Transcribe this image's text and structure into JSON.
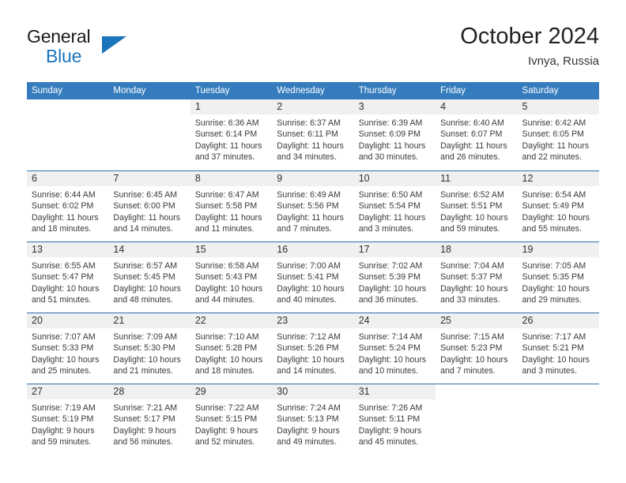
{
  "brand": {
    "name_part1": "General",
    "name_part2": "Blue",
    "accent_color": "#1b75bb"
  },
  "header": {
    "title": "October 2024",
    "location": "Ivnya, Russia"
  },
  "theme": {
    "header_bar_color": "#357cbe",
    "row_separator_color": "#2f6fae",
    "day_number_band_color": "#f0f0f0"
  },
  "weekdays": [
    "Sunday",
    "Monday",
    "Tuesday",
    "Wednesday",
    "Thursday",
    "Friday",
    "Saturday"
  ],
  "weeks": [
    [
      {
        "day": "",
        "empty": true
      },
      {
        "day": "",
        "empty": true
      },
      {
        "day": "1",
        "sunrise": "Sunrise: 6:36 AM",
        "sunset": "Sunset: 6:14 PM",
        "daylight": "Daylight: 11 hours and 37 minutes."
      },
      {
        "day": "2",
        "sunrise": "Sunrise: 6:37 AM",
        "sunset": "Sunset: 6:11 PM",
        "daylight": "Daylight: 11 hours and 34 minutes."
      },
      {
        "day": "3",
        "sunrise": "Sunrise: 6:39 AM",
        "sunset": "Sunset: 6:09 PM",
        "daylight": "Daylight: 11 hours and 30 minutes."
      },
      {
        "day": "4",
        "sunrise": "Sunrise: 6:40 AM",
        "sunset": "Sunset: 6:07 PM",
        "daylight": "Daylight: 11 hours and 26 minutes."
      },
      {
        "day": "5",
        "sunrise": "Sunrise: 6:42 AM",
        "sunset": "Sunset: 6:05 PM",
        "daylight": "Daylight: 11 hours and 22 minutes."
      }
    ],
    [
      {
        "day": "6",
        "sunrise": "Sunrise: 6:44 AM",
        "sunset": "Sunset: 6:02 PM",
        "daylight": "Daylight: 11 hours and 18 minutes."
      },
      {
        "day": "7",
        "sunrise": "Sunrise: 6:45 AM",
        "sunset": "Sunset: 6:00 PM",
        "daylight": "Daylight: 11 hours and 14 minutes."
      },
      {
        "day": "8",
        "sunrise": "Sunrise: 6:47 AM",
        "sunset": "Sunset: 5:58 PM",
        "daylight": "Daylight: 11 hours and 11 minutes."
      },
      {
        "day": "9",
        "sunrise": "Sunrise: 6:49 AM",
        "sunset": "Sunset: 5:56 PM",
        "daylight": "Daylight: 11 hours and 7 minutes."
      },
      {
        "day": "10",
        "sunrise": "Sunrise: 6:50 AM",
        "sunset": "Sunset: 5:54 PM",
        "daylight": "Daylight: 11 hours and 3 minutes."
      },
      {
        "day": "11",
        "sunrise": "Sunrise: 6:52 AM",
        "sunset": "Sunset: 5:51 PM",
        "daylight": "Daylight: 10 hours and 59 minutes."
      },
      {
        "day": "12",
        "sunrise": "Sunrise: 6:54 AM",
        "sunset": "Sunset: 5:49 PM",
        "daylight": "Daylight: 10 hours and 55 minutes."
      }
    ],
    [
      {
        "day": "13",
        "sunrise": "Sunrise: 6:55 AM",
        "sunset": "Sunset: 5:47 PM",
        "daylight": "Daylight: 10 hours and 51 minutes."
      },
      {
        "day": "14",
        "sunrise": "Sunrise: 6:57 AM",
        "sunset": "Sunset: 5:45 PM",
        "daylight": "Daylight: 10 hours and 48 minutes."
      },
      {
        "day": "15",
        "sunrise": "Sunrise: 6:58 AM",
        "sunset": "Sunset: 5:43 PM",
        "daylight": "Daylight: 10 hours and 44 minutes."
      },
      {
        "day": "16",
        "sunrise": "Sunrise: 7:00 AM",
        "sunset": "Sunset: 5:41 PM",
        "daylight": "Daylight: 10 hours and 40 minutes."
      },
      {
        "day": "17",
        "sunrise": "Sunrise: 7:02 AM",
        "sunset": "Sunset: 5:39 PM",
        "daylight": "Daylight: 10 hours and 36 minutes."
      },
      {
        "day": "18",
        "sunrise": "Sunrise: 7:04 AM",
        "sunset": "Sunset: 5:37 PM",
        "daylight": "Daylight: 10 hours and 33 minutes."
      },
      {
        "day": "19",
        "sunrise": "Sunrise: 7:05 AM",
        "sunset": "Sunset: 5:35 PM",
        "daylight": "Daylight: 10 hours and 29 minutes."
      }
    ],
    [
      {
        "day": "20",
        "sunrise": "Sunrise: 7:07 AM",
        "sunset": "Sunset: 5:33 PM",
        "daylight": "Daylight: 10 hours and 25 minutes."
      },
      {
        "day": "21",
        "sunrise": "Sunrise: 7:09 AM",
        "sunset": "Sunset: 5:30 PM",
        "daylight": "Daylight: 10 hours and 21 minutes."
      },
      {
        "day": "22",
        "sunrise": "Sunrise: 7:10 AM",
        "sunset": "Sunset: 5:28 PM",
        "daylight": "Daylight: 10 hours and 18 minutes."
      },
      {
        "day": "23",
        "sunrise": "Sunrise: 7:12 AM",
        "sunset": "Sunset: 5:26 PM",
        "daylight": "Daylight: 10 hours and 14 minutes."
      },
      {
        "day": "24",
        "sunrise": "Sunrise: 7:14 AM",
        "sunset": "Sunset: 5:24 PM",
        "daylight": "Daylight: 10 hours and 10 minutes."
      },
      {
        "day": "25",
        "sunrise": "Sunrise: 7:15 AM",
        "sunset": "Sunset: 5:23 PM",
        "daylight": "Daylight: 10 hours and 7 minutes."
      },
      {
        "day": "26",
        "sunrise": "Sunrise: 7:17 AM",
        "sunset": "Sunset: 5:21 PM",
        "daylight": "Daylight: 10 hours and 3 minutes."
      }
    ],
    [
      {
        "day": "27",
        "sunrise": "Sunrise: 7:19 AM",
        "sunset": "Sunset: 5:19 PM",
        "daylight": "Daylight: 9 hours and 59 minutes."
      },
      {
        "day": "28",
        "sunrise": "Sunrise: 7:21 AM",
        "sunset": "Sunset: 5:17 PM",
        "daylight": "Daylight: 9 hours and 56 minutes."
      },
      {
        "day": "29",
        "sunrise": "Sunrise: 7:22 AM",
        "sunset": "Sunset: 5:15 PM",
        "daylight": "Daylight: 9 hours and 52 minutes."
      },
      {
        "day": "30",
        "sunrise": "Sunrise: 7:24 AM",
        "sunset": "Sunset: 5:13 PM",
        "daylight": "Daylight: 9 hours and 49 minutes."
      },
      {
        "day": "31",
        "sunrise": "Sunrise: 7:26 AM",
        "sunset": "Sunset: 5:11 PM",
        "daylight": "Daylight: 9 hours and 45 minutes."
      },
      {
        "day": "",
        "empty": true
      },
      {
        "day": "",
        "empty": true
      }
    ]
  ]
}
